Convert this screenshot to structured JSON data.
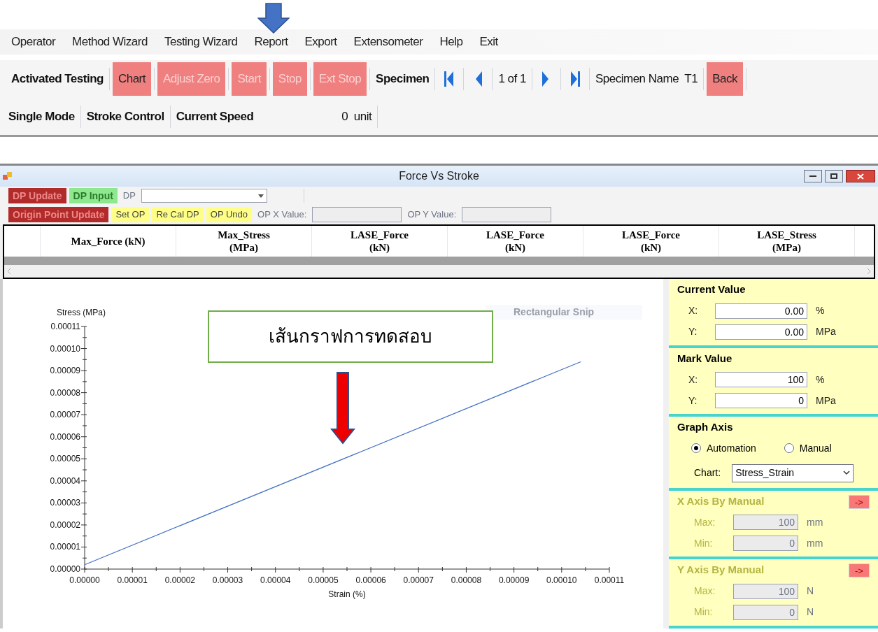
{
  "menu": [
    "Operator",
    "Method Wizard",
    "Testing Wizard",
    "Report",
    "Export",
    "Extensometer",
    "Help",
    "Exit"
  ],
  "toolbar": [
    {
      "kind": "label",
      "text": "Activated Testing"
    },
    {
      "kind": "button",
      "text": "Chart",
      "disabled": false
    },
    {
      "kind": "button",
      "text": "Adjust Zero",
      "disabled": true
    },
    {
      "kind": "button",
      "text": "Start",
      "disabled": true
    },
    {
      "kind": "button",
      "text": "Stop",
      "disabled": true
    },
    {
      "kind": "button",
      "text": "Ext Stop",
      "disabled": true
    },
    {
      "kind": "label",
      "text": "Specimen"
    },
    {
      "kind": "first"
    },
    {
      "kind": "prev"
    },
    {
      "kind": "text",
      "text": "1 of 1"
    },
    {
      "kind": "next"
    },
    {
      "kind": "last"
    },
    {
      "kind": "text",
      "text": "Specimen Name  T1"
    },
    {
      "kind": "button",
      "text": "Back",
      "disabled": false
    }
  ],
  "status_toolbar": [
    {
      "kind": "label",
      "text": "Single Mode"
    },
    {
      "kind": "label",
      "text": "Stroke Control"
    },
    {
      "kind": "label",
      "text": "Current Speed"
    },
    {
      "kind": "text",
      "text": "0  unit"
    }
  ],
  "window": {
    "title": "Force Vs Stroke",
    "dp_toolbar": [
      {
        "kind": "button",
        "text": "DP Update",
        "color": "#b22b2b"
      },
      {
        "kind": "button",
        "text": "DP Input",
        "color": "#8ee88e"
      },
      {
        "kind": "label",
        "text": "DP"
      },
      {
        "kind": "combo"
      }
    ],
    "op_toolbar": [
      {
        "kind": "button",
        "text": "Origin Point Update",
        "color": "#b22b2b"
      },
      {
        "kind": "button",
        "text": "Set OP",
        "color": "#ffff88"
      },
      {
        "kind": "button",
        "text": "Re Cal DP",
        "color": "#ffff88"
      },
      {
        "kind": "button",
        "text": "OP Undo",
        "color": "#ffff88"
      },
      {
        "kind": "label",
        "text": "OP X Value:"
      },
      {
        "kind": "field"
      },
      {
        "kind": "label",
        "text": "OP Y Value:"
      },
      {
        "kind": "field"
      }
    ],
    "table": {
      "columns": [
        "Max_Force (kN)",
        "Max_Stress\n(MPa)",
        "LASE_Force\n(kN)",
        "LASE_Force\n(kN)",
        "LASE_Force\n(kN)",
        "LASE_Stress\n(MPa)"
      ]
    },
    "chart_data": {
      "type": "line",
      "xlabel": "Strain (%)",
      "ylabel": "Stress (MPa)",
      "x": [
        0,
        0.000104
      ],
      "series": [
        {
          "color": "#4472c4",
          "values": [
            2e-06,
            9.4e-05
          ]
        }
      ],
      "xlim": [
        0,
        0.00011
      ],
      "ylim": [
        0,
        0.00011
      ],
      "xticks": [
        {
          "value": 0,
          "label": "0.00000"
        },
        {
          "value": 1e-05,
          "label": "0.00001"
        },
        {
          "value": 2e-05,
          "label": "0.00002"
        },
        {
          "value": 3e-05,
          "label": "0.00003"
        },
        {
          "value": 4e-05,
          "label": "0.00004"
        },
        {
          "value": 5e-05,
          "label": "0.00005"
        },
        {
          "value": 6e-05,
          "label": "0.00006"
        },
        {
          "value": 7e-05,
          "label": "0.00007"
        },
        {
          "value": 8e-05,
          "label": "0.00008"
        },
        {
          "value": 9e-05,
          "label": "0.00009"
        },
        {
          "value": 0.0001,
          "label": "0.00010"
        },
        {
          "value": 0.00011,
          "label": "0.00011"
        }
      ],
      "yticks": [
        {
          "value": 0,
          "label": "0.00000"
        },
        {
          "value": 1e-05,
          "label": "0.00001"
        },
        {
          "value": 2e-05,
          "label": "0.00002"
        },
        {
          "value": 3e-05,
          "label": "0.00003"
        },
        {
          "value": 4e-05,
          "label": "0.00004"
        },
        {
          "value": 5e-05,
          "label": "0.00005"
        },
        {
          "value": 6e-05,
          "label": "0.00006"
        },
        {
          "value": 7e-05,
          "label": "0.00007"
        },
        {
          "value": 8e-05,
          "label": "0.00008"
        },
        {
          "value": 9e-05,
          "label": "0.00009"
        },
        {
          "value": 0.0001,
          "label": "0.00010"
        },
        {
          "value": 0.00011,
          "label": "0.00011"
        }
      ]
    },
    "snip_hint": "Rectangular Snip",
    "annotation": "เส้นกราฟการทดสอบ",
    "panel": [
      {
        "kind": "values",
        "title": "Current Value",
        "disabled": false,
        "rows": [
          {
            "label": "X:",
            "value": "0.00",
            "unit": "%"
          },
          {
            "label": "Y:",
            "value": "0.00",
            "unit": "MPa"
          }
        ]
      },
      {
        "kind": "values",
        "title": "Mark Value",
        "disabled": false,
        "rows": [
          {
            "label": "X:",
            "value": "100",
            "unit": "%"
          },
          {
            "label": "Y:",
            "value": "0",
            "unit": "MPa"
          }
        ]
      },
      {
        "kind": "axis",
        "title": "Graph Axis",
        "radios": [
          {
            "label": "Automation",
            "selected": true
          },
          {
            "label": "Manual",
            "selected": false
          }
        ],
        "select_label": "Chart:",
        "select_value": "Stress_Strain"
      },
      {
        "kind": "values",
        "title": "X Axis By Manual",
        "disabled": true,
        "button": "->",
        "rows": [
          {
            "label": "Max:",
            "value": "100",
            "unit": "mm"
          },
          {
            "label": "Min:",
            "value": "0",
            "unit": "mm"
          }
        ]
      },
      {
        "kind": "values",
        "title": "Y Axis By Manual",
        "disabled": true,
        "button": "->",
        "rows": [
          {
            "label": "Max:",
            "value": "100",
            "unit": "N"
          },
          {
            "label": "Min:",
            "value": "0",
            "unit": "N"
          }
        ]
      }
    ]
  }
}
